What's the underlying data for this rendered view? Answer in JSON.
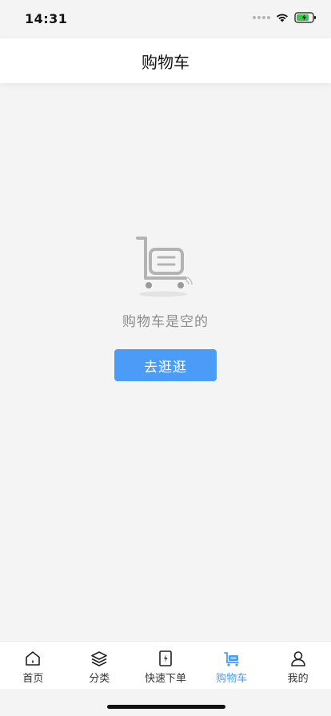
{
  "status_bar": {
    "time": "14:31"
  },
  "nav": {
    "title": "购物车"
  },
  "empty_state": {
    "message": "购物车是空的",
    "button_label": "去逛逛"
  },
  "tabs": [
    {
      "label": "首页",
      "icon": "home-icon",
      "active": false
    },
    {
      "label": "分类",
      "icon": "layers-icon",
      "active": false
    },
    {
      "label": "快速下单",
      "icon": "quick-order-icon",
      "active": false
    },
    {
      "label": "购物车",
      "icon": "cart-icon",
      "active": true
    },
    {
      "label": "我的",
      "icon": "user-icon",
      "active": false
    }
  ],
  "colors": {
    "accent": "#4a9cf6",
    "background": "#f4f4f5"
  }
}
